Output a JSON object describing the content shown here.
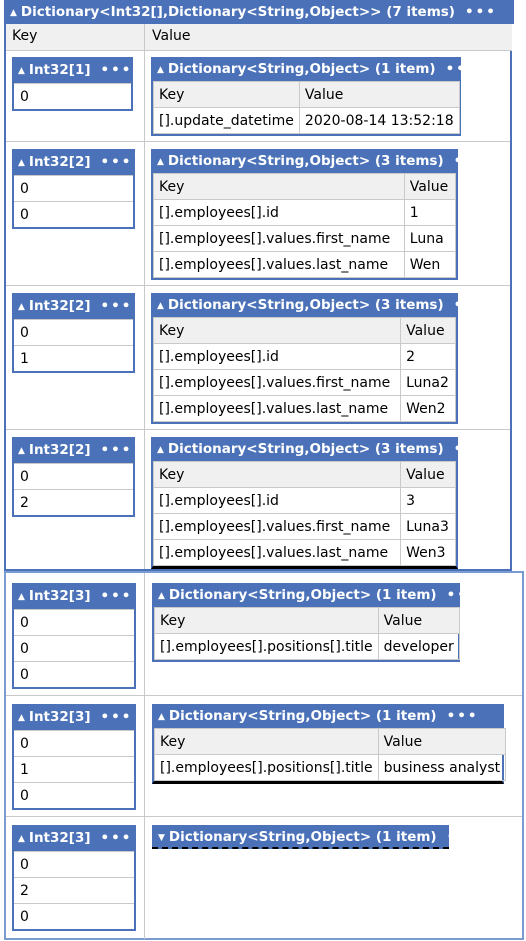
{
  "outer": {
    "title": "Dictionary<Int32[],Dictionary<String,Object>> (7 items)",
    "more": "•••",
    "col_key": "Key",
    "col_value": "Value"
  },
  "rows": [
    {
      "key_title": "Int32[1]",
      "key_values": [
        "0"
      ],
      "dict_title": "Dictionary<String,Object> (1 item)",
      "entries": [
        [
          "[].update_datetime",
          "2020-08-14 13:52:18"
        ]
      ]
    },
    {
      "key_title": "Int32[2]",
      "key_values": [
        "0",
        "0"
      ],
      "dict_title": "Dictionary<String,Object> (3 items)",
      "entries": [
        [
          "[].employees[].id",
          "1"
        ],
        [
          "[].employees[].values.first_name",
          "Luna"
        ],
        [
          "[].employees[].values.last_name",
          "Wen"
        ]
      ]
    },
    {
      "key_title": "Int32[2]",
      "key_values": [
        "0",
        "1"
      ],
      "dict_title": "Dictionary<String,Object> (3 items)",
      "entries": [
        [
          "[].employees[].id",
          "2"
        ],
        [
          "[].employees[].values.first_name",
          "Luna2"
        ],
        [
          "[].employees[].values.last_name",
          "Wen2"
        ]
      ]
    },
    {
      "key_title": "Int32[2]",
      "key_values": [
        "0",
        "2"
      ],
      "dict_title": "Dictionary<String,Object> (3 items)",
      "entries": [
        [
          "[].employees[].id",
          "3"
        ],
        [
          "[].employees[].values.first_name",
          "Luna3"
        ],
        [
          "[].employees[].values.last_name",
          "Wen3"
        ]
      ]
    },
    {
      "key_title": "Int32[3]",
      "key_values": [
        "0",
        "0",
        "0"
      ],
      "dict_title": "Dictionary<String,Object> (1 item)",
      "entries": [
        [
          "[].employees[].positions[].title",
          "developer"
        ]
      ]
    },
    {
      "key_title": "Int32[3]",
      "key_values": [
        "0",
        "1",
        "0"
      ],
      "dict_title": "Dictionary<String,Object> (1 item)",
      "entries": [
        [
          "[].employees[].positions[].title",
          "business analyst"
        ]
      ]
    },
    {
      "key_title": "Int32[3]",
      "key_values": [
        "0",
        "2",
        "0"
      ],
      "dict_title": "Dictionary<String,Object> (1 item)",
      "collapsed": true
    }
  ],
  "labels": {
    "key": "Key",
    "value": "Value",
    "more": "•••",
    "expanded_glyph": "▲",
    "collapsed_glyph": "▼"
  }
}
